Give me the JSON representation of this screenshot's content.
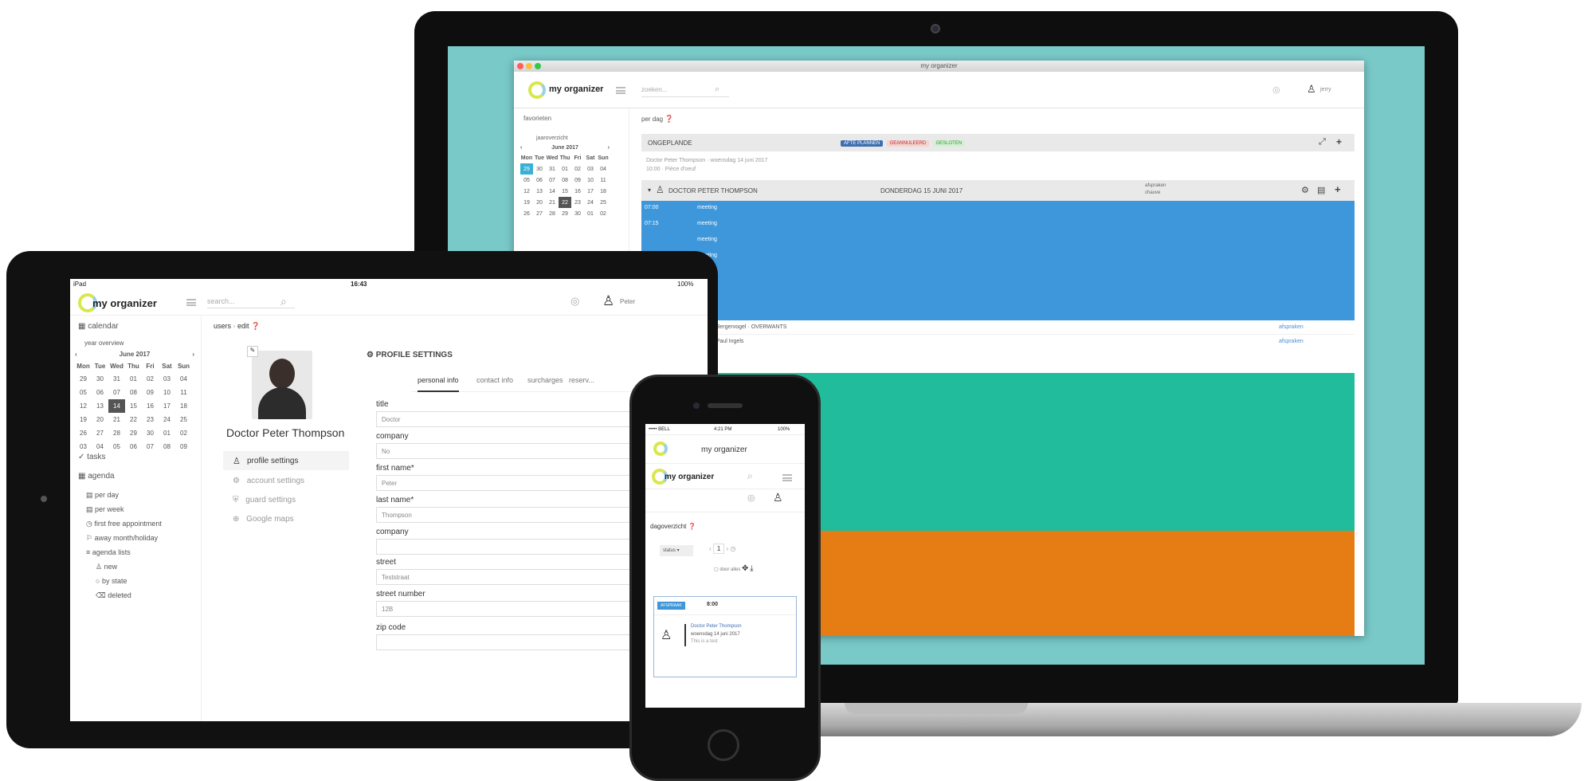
{
  "laptop": {
    "window_title": "my organizer",
    "brand": "my organizer",
    "search_placeholder": "zoeken...",
    "user": "jerry",
    "breadcrumb": "per dag",
    "sidebar": {
      "favorites": "favorieten",
      "heading": "jaaroverzicht",
      "month": "June 2017",
      "weekdays": [
        "Mon",
        "Tue",
        "Wed",
        "Thu",
        "Fri",
        "Sat",
        "Sun"
      ],
      "weeks": [
        [
          "29",
          "30",
          "31",
          "01",
          "02",
          "03",
          "04"
        ],
        [
          "05",
          "06",
          "07",
          "08",
          "09",
          "10",
          "11"
        ],
        [
          "12",
          "13",
          "14",
          "15",
          "16",
          "17",
          "18"
        ],
        [
          "19",
          "20",
          "21",
          "22",
          "23",
          "24",
          "25"
        ],
        [
          "26",
          "27",
          "28",
          "29",
          "30",
          "01",
          "02"
        ]
      ]
    },
    "group1": {
      "title": "ONGEPLANDE",
      "tags": [
        "AFTE PLANNEN",
        "GEANNULEERD",
        "GESLOTEN"
      ],
      "note_line1": "Doctor Peter Thompson · woensdag 14 juni 2017",
      "note_line2": "10:00 · Pièce d'oeuf"
    },
    "group2": {
      "title": "DOCTOR PETER THOMPSON",
      "date": "DONDERDAG 15 JUNI 2017",
      "meta1": "afspraken",
      "meta2": "chauve",
      "slot1_time": "07:00",
      "slot1_label": "meeting",
      "slot2_time": "07:15",
      "slot2_label": "meeting",
      "labels": [
        "meeting",
        "meeting",
        "meeting",
        "meeting",
        "meeting"
      ],
      "appt1": "09:00 · Bergervogel · OVERWANTS",
      "appt1_right": "afspraken",
      "appt2": "09:15 · Paul Ingels",
      "appt2_right": "afspraken"
    },
    "colors": {
      "blue": "#3d97da",
      "green": "#20bc9c",
      "orange": "#e67d14",
      "wall": "#79c9c8"
    }
  },
  "tablet": {
    "status_left": "iPad",
    "status_time": "16:43",
    "status_right": "100%",
    "brand": "my organizer",
    "search_placeholder": "search...",
    "user": "Peter",
    "breadcrumb_1": "users",
    "breadcrumb_2": "edit",
    "sidebar": {
      "calendar": "calendar",
      "year_overview": "year overview",
      "month": "June 2017",
      "weekdays": [
        "Mon",
        "Tue",
        "Wed",
        "Thu",
        "Fri",
        "Sat",
        "Sun"
      ],
      "weeks": [
        [
          "29",
          "30",
          "31",
          "01",
          "02",
          "03",
          "04"
        ],
        [
          "05",
          "06",
          "07",
          "08",
          "09",
          "10",
          "11"
        ],
        [
          "12",
          "13",
          "14",
          "15",
          "16",
          "17",
          "18"
        ],
        [
          "19",
          "20",
          "21",
          "22",
          "23",
          "24",
          "25"
        ],
        [
          "26",
          "27",
          "28",
          "29",
          "30",
          "01",
          "02"
        ],
        [
          "03",
          "04",
          "05",
          "06",
          "07",
          "08",
          "09"
        ]
      ],
      "tasks": "tasks",
      "agenda": "agenda",
      "agenda_items": [
        "per day",
        "per week",
        "first free appointment",
        "away month/holiday",
        "agenda lists"
      ],
      "list_items": [
        "new",
        "by state",
        "deleted"
      ]
    },
    "profile_name": "Doctor Peter Thompson",
    "profile_nav": [
      "profile settings",
      "account settings",
      "guard settings",
      "Google maps"
    ],
    "settings_title": "PROFILE SETTINGS",
    "tabs": [
      "personal info",
      "contact info",
      "surcharges",
      "reserv..."
    ],
    "fields": [
      {
        "label": "title",
        "value": "Doctor"
      },
      {
        "label": "company",
        "value": "No"
      },
      {
        "label": "first name*",
        "value": "Peter"
      },
      {
        "label": "last name*",
        "value": "Thompson"
      },
      {
        "label": "company",
        "value": ""
      },
      {
        "label": "street",
        "value": "Teststraat"
      },
      {
        "label": "street number",
        "value": "12B"
      },
      {
        "label": "zip code",
        "value": ""
      }
    ]
  },
  "phone": {
    "status_left": "••••• BELL",
    "status_time": "4:21 PM",
    "status_right": "100%",
    "app_title": "my organizer",
    "brand": "my organizer",
    "heading": "dagoverzicht",
    "filter": "status",
    "page": "1",
    "toggle_label": "door alles",
    "card_tag": "AFSPRAAK",
    "card_time": "8:00",
    "card_name": "Doctor Peter Thompson",
    "card_date": "woensdag 14 juni 2017",
    "card_note": "This is a test"
  }
}
